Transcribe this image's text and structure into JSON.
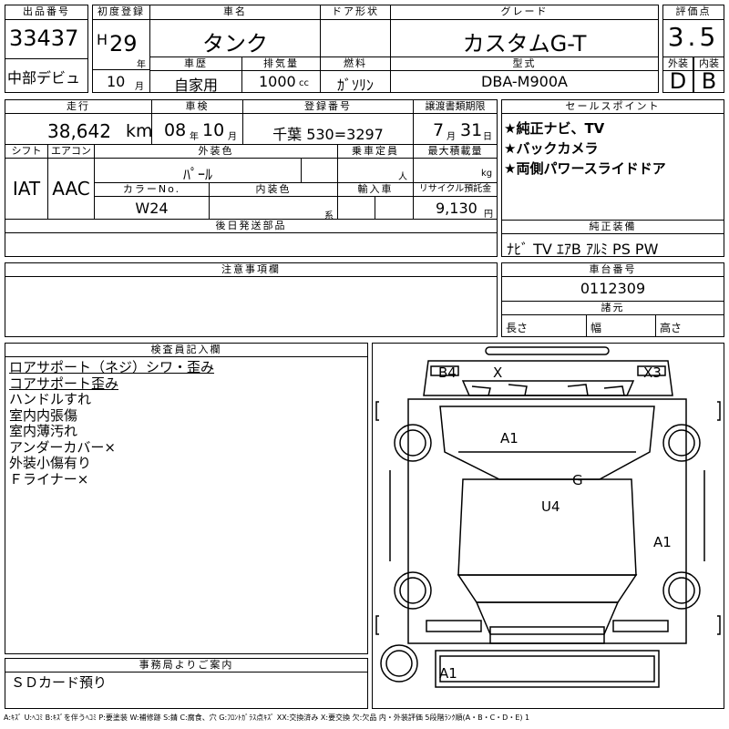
{
  "header": {
    "lot_no_label": "出品番号",
    "lot_no": "33437",
    "source": "中部デビュ",
    "first_reg_label": "初度登録",
    "era": "H",
    "year": "29",
    "year_unit": "年",
    "month": "10",
    "month_unit": "月",
    "car_name_label": "車名",
    "car_name": "タンク",
    "door_label": "ドア形状",
    "door": "",
    "grade_label": "グレード",
    "grade": "カスタムG-T",
    "score_label": "評価点",
    "score": "3.5",
    "history_label": "車歴",
    "history": "自家用",
    "displacement_label": "排気量",
    "displacement": "1000",
    "displacement_unit": "cc",
    "fuel_label": "燃料",
    "fuel": "ｶﾞｿﾘﾝ",
    "model_label": "型式",
    "model": "DBA-M900A",
    "exterior_label": "外装",
    "exterior": "D",
    "interior_label": "内装",
    "interior": "B"
  },
  "details": {
    "mileage_label": "走行",
    "mileage": "38,642",
    "mileage_unit": "km",
    "inspection_label": "車検",
    "inspection_year": "08",
    "inspection_year_unit": "年",
    "inspection_month": "10",
    "inspection_month_unit": "月",
    "plate_label": "登録番号",
    "plate": "千葉 530=3297",
    "transfer_label": "譲渡書類期限",
    "transfer_month": "7",
    "transfer_month_unit": "月",
    "transfer_day": "31",
    "transfer_day_unit": "日",
    "shift_label": "シフト",
    "shift": "IAT",
    "aircon_label": "エアコン",
    "aircon": "AAC",
    "ext_color_label": "外装色",
    "ext_color": "ﾊﾟｰﾙ",
    "capacity_label": "乗車定員",
    "capacity_unit": "人",
    "load_label": "最大積載量",
    "load_unit": "kg",
    "color_no_label": "カラーNo.",
    "color_no": "W24",
    "int_color_label": "内装色",
    "int_color_unit": "系",
    "import_label": "輸入車",
    "recycle_label": "リサイクル預託金",
    "recycle": "9,130",
    "recycle_unit": "円",
    "later_parts_label": "後日発送部品",
    "later_parts": "",
    "notes_label": "注意事項欄",
    "notes": ""
  },
  "sales": {
    "label": "セールスポイント",
    "items": [
      "★純正ナビ、TV",
      "★バックカメラ",
      "★両側パワースライドドア"
    ]
  },
  "equipment": {
    "label": "純正装備",
    "value": "ﾅﾋﾞ TV ｴｱB ｱﾙﾐ PS PW"
  },
  "chassis": {
    "label": "車台番号",
    "value": "0112309"
  },
  "specs": {
    "label": "諸元",
    "length_label": "長さ",
    "width_label": "幅",
    "height_label": "高さ"
  },
  "inspector": {
    "label": "検査員記入欄",
    "lines": [
      "ロアサポート（ネジ）シワ・歪み",
      "コアサポート歪み",
      "ハンドルすれ",
      "室内内張傷",
      "室内薄汚れ",
      "アンダーカバー×",
      "外装小傷有り",
      "Ｆライナー×"
    ]
  },
  "office": {
    "label": "事務局よりご案内",
    "text": "ＳＤカード預り"
  },
  "diagram": {
    "marks": [
      "B4",
      "X",
      "X3",
      "A1",
      "G",
      "U4",
      "A1",
      "A1"
    ]
  },
  "legend": "A:ｷｽﾞ U:ﾍｺﾐ B:ｷｽﾞを伴うﾍｺﾐ P:要塗装 W:補修跡 S:錆 C:腐食、穴 G:ﾌﾛﾝﾄｶﾞﾗｽ点ｷｽﾞ XX:交換済み X:要交換 欠:欠品 内・外装評価 5段階ﾗﾝｸ順(A・B・C・D・E) 1"
}
